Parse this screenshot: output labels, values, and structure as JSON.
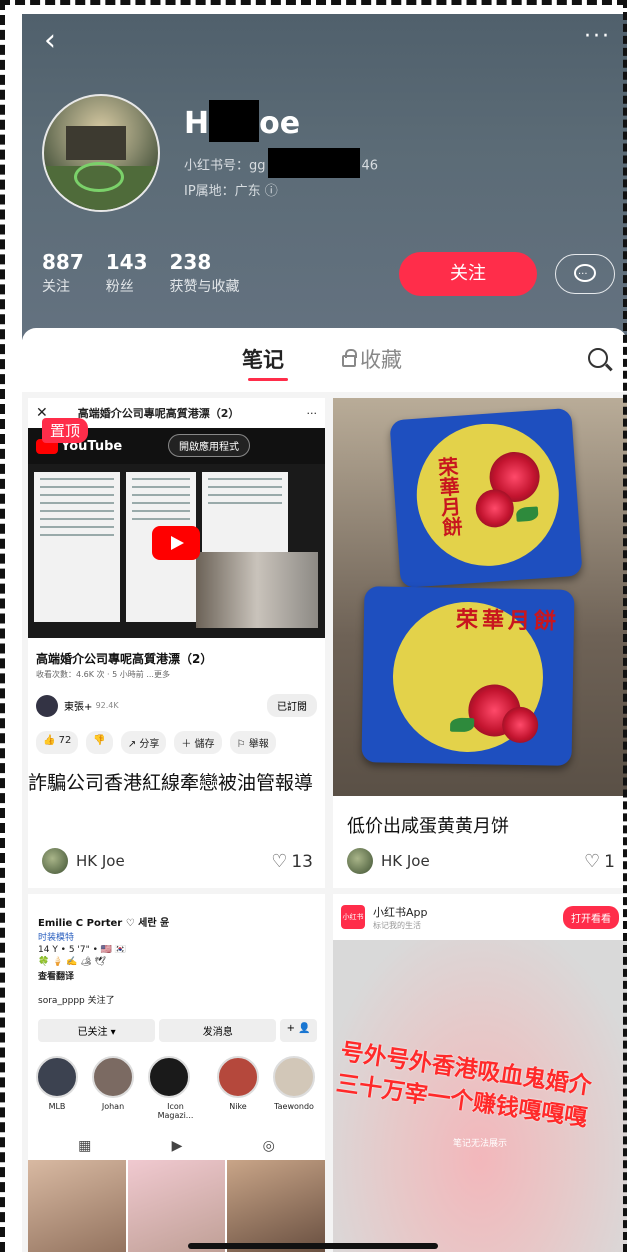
{
  "header": {
    "back_icon": "chevron-left-icon",
    "more_label": "···",
    "name_prefix": "H",
    "name_suffix": "oe",
    "rednote_id_prefix": "小红书号：gg",
    "rednote_id_suffix": "46",
    "ip_location": "IP属地：广东 ⓘ",
    "stats": [
      {
        "num": "887",
        "label": "关注"
      },
      {
        "num": "143",
        "label": "粉丝"
      },
      {
        "num": "238",
        "label": "获赞与收藏"
      }
    ],
    "follow_label": "关注"
  },
  "tabs": {
    "notes": "笔记",
    "collections": "收藏"
  },
  "card1": {
    "pinned": "置顶",
    "yt_close": "✕",
    "yt_bar_title": "高端婚介公司專呢高質港漂（2）",
    "yt_bar_more": "···",
    "yt_logo": "YouTube",
    "yt_open_app": "開啟應用程式",
    "yt_title": "高端婚介公司專呢高質港漂（2）",
    "yt_meta": "收看次數：4.6K 次 · 5 小時前 ...更多",
    "yt_channel": "東張+",
    "yt_channel_subs": "92.4K",
    "yt_subscribed": "已訂閱",
    "yt_actions": [
      "👍 72",
      "👎",
      "↗ 分享",
      "＋ 儲存",
      "⚐ 舉報"
    ],
    "title": "詐騙公司香港紅線牽戀被油管報導",
    "user": "HK Joe",
    "likes": "13"
  },
  "card2": {
    "box_text_top": "荣華月餅",
    "box_text_bottom": "荣華月餅",
    "title": "低价出咸蛋黄黄月饼",
    "user": "HK Joe",
    "likes": "1"
  },
  "card3": {
    "ig_name": "Emilie C Porter ♡ 세란 윤",
    "ig_line1": "时装模特",
    "ig_line2": "14 Y • 5 '7\" • 🇺🇸 🇰🇷",
    "ig_line3": "🍀 🍦 ✍️ 🏕 🕊",
    "ig_translate": "查看翻译",
    "ig_followed_by": "sora_pppp 关注了",
    "ig_btn_following": "已关注 ▾",
    "ig_btn_message": "发消息",
    "ig_btn_add": "+ 👤",
    "highlights": [
      "MLB",
      "Johan",
      "Icon Magazi...",
      "Nike",
      "Taewondo"
    ],
    "ig_tabs": [
      "▦",
      "▶",
      "◎"
    ]
  },
  "card4": {
    "app_icon": "小红书",
    "app_name": "小红书App",
    "app_slogan": "标记我的生活",
    "open_label": "打开看看",
    "headline_line1": "号外号外香港吸血鬼婚介",
    "headline_line2": "三十万宰一个赚钱嘎嘎嘎",
    "watermark": "笔记无法展示"
  }
}
